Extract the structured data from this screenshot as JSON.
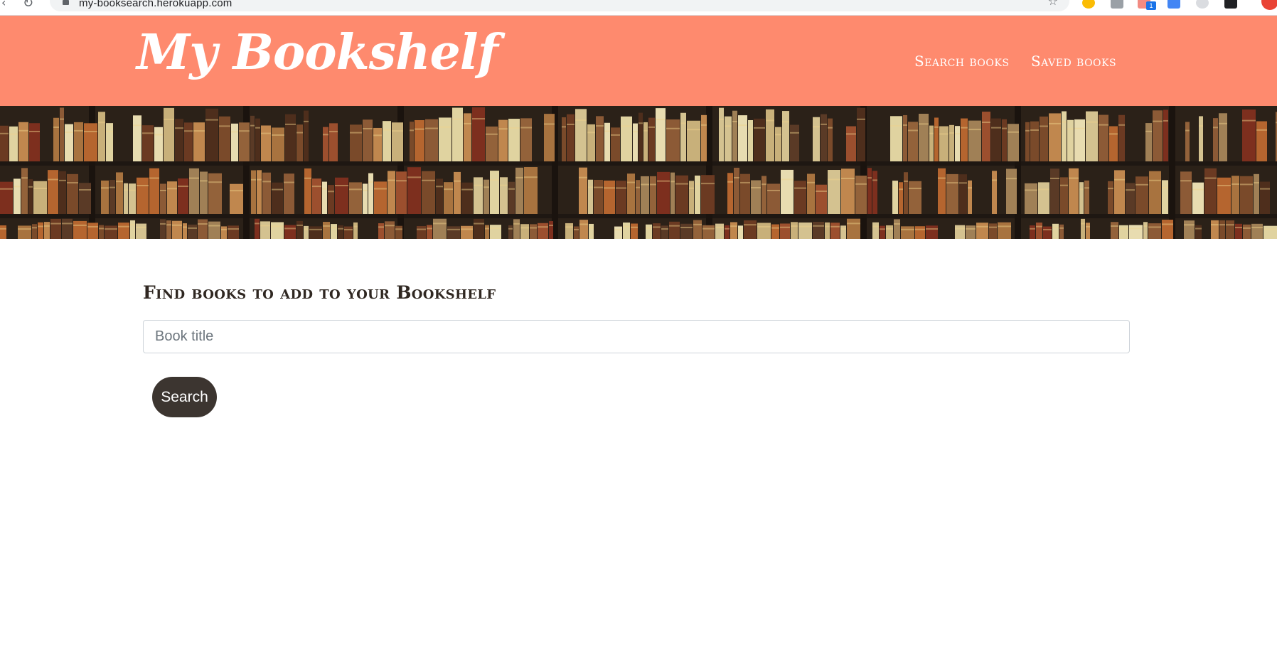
{
  "browser": {
    "url": "my-booksearch.herokuapp.com",
    "extension_badge": "1"
  },
  "navbar": {
    "brand": "My Bookshelf",
    "links": [
      {
        "label": "Search books"
      },
      {
        "label": "Saved books"
      }
    ],
    "background_color": "#fe8a6e"
  },
  "banner": {
    "image": "bookshelf-banner"
  },
  "search": {
    "heading": "Find books to add to your Bookshelf",
    "input_value": "",
    "input_placeholder": "Book title",
    "button_label": "Search",
    "button_color": "#3c3530"
  }
}
